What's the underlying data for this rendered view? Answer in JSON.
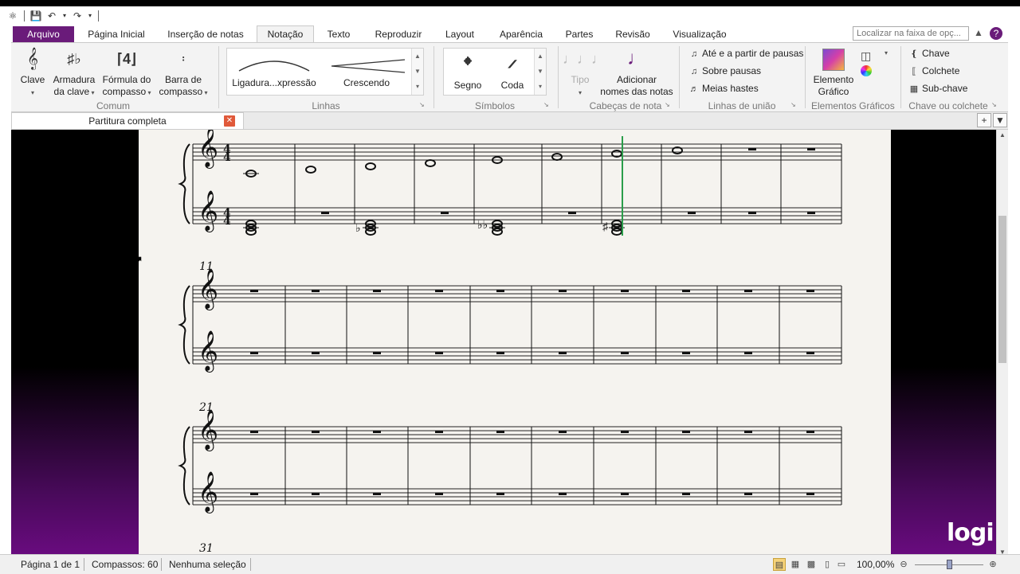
{
  "quick_access": {
    "icons": [
      "app-logo-icon",
      "save-icon",
      "undo-icon",
      "redo-icon"
    ]
  },
  "tabs": {
    "file": "Arquivo",
    "items": [
      "Página Inicial",
      "Inserção de notas",
      "Notação",
      "Texto",
      "Reproduzir",
      "Layout",
      "Aparência",
      "Partes",
      "Revisão",
      "Visualização"
    ],
    "active": "Notação",
    "search_placeholder": "Localizar na faixa de opç..."
  },
  "ribbon": {
    "comum": {
      "label": "Comum",
      "clave": "Clave",
      "armadura_1": "Armadura",
      "armadura_2": "da clave",
      "formula_1": "Fórmula do",
      "formula_2": "compasso",
      "barra_1": "Barra de",
      "barra_2": "compasso"
    },
    "linhas": {
      "label": "Linhas",
      "item1": "Ligadura...xpressão",
      "item2": "Crescendo"
    },
    "simbolos": {
      "label": "Símbolos",
      "item1": "Segno",
      "item2": "Coda"
    },
    "cabecas": {
      "label": "Cabeças de nota",
      "tipo": "Tipo",
      "adicionar_1": "Adicionar",
      "adicionar_2": "nomes das notas"
    },
    "linhas_uniao": {
      "label": "Linhas de união",
      "item1": "Até e a partir de pausas",
      "item2": "Sobre pausas",
      "item3": "Meias hastes"
    },
    "elementos": {
      "label": "Elementos Gráficos",
      "item_1": "Elemento",
      "item_2": "Gráfico"
    },
    "chave": {
      "label": "Chave ou colchete",
      "item1": "Chave",
      "item2": "Colchete",
      "item3": "Sub-chave"
    }
  },
  "document_tab": {
    "title": "Partitura completa"
  },
  "score": {
    "time_signature": [
      "4",
      "4"
    ],
    "system_numbers": [
      "11",
      "21",
      "31"
    ]
  },
  "watermark": "logi",
  "statusbar": {
    "page": "Página 1 de 1",
    "bars": "Compassos: 60",
    "selection": "Nenhuma seleção",
    "zoom": "100,00%",
    "zoom_level": 0.5
  }
}
